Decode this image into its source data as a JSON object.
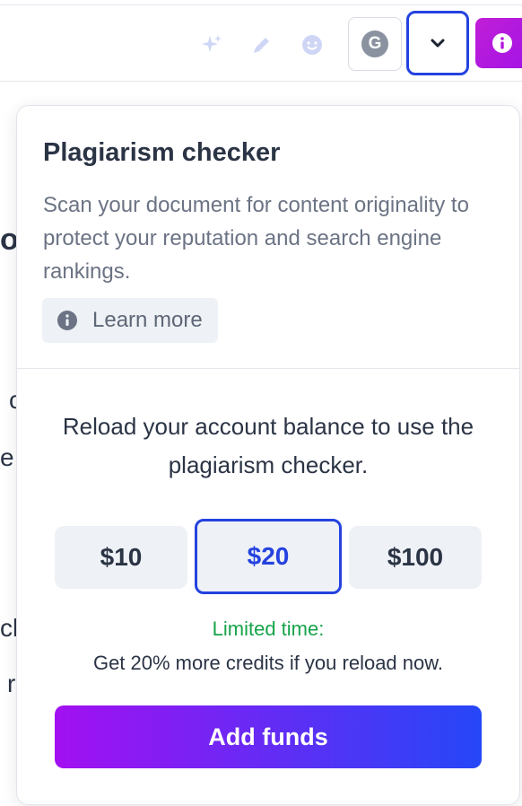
{
  "toolbar": {
    "icons": [
      "sparkle-icon",
      "pen-icon",
      "smiley-icon"
    ],
    "grammarly_letter": "G",
    "chevron": "chevron-down-icon",
    "info_letter": "i"
  },
  "background": {
    "fragments": [
      "ou",
      "c",
      "e",
      "cli",
      "r"
    ]
  },
  "popup": {
    "title": "Plagiarism checker",
    "description": "Scan your document for content originality to protect your reputation and search engine rankings.",
    "learn_more": "Learn more",
    "reload_text": "Reload your account balance to use the plagiarism checker.",
    "amounts": [
      {
        "label": "$10",
        "selected": false
      },
      {
        "label": "$20",
        "selected": true
      },
      {
        "label": "$100",
        "selected": false
      }
    ],
    "limited_time": "Limited time:",
    "bonus_text": "Get 20% more credits if you reload now.",
    "add_funds": "Add funds"
  },
  "colors": {
    "accent_blue": "#2442e0",
    "promo_green": "#17a34a",
    "gradient_start": "#a310f2",
    "gradient_end": "#2547f7",
    "info_purple": "#b617dc"
  }
}
